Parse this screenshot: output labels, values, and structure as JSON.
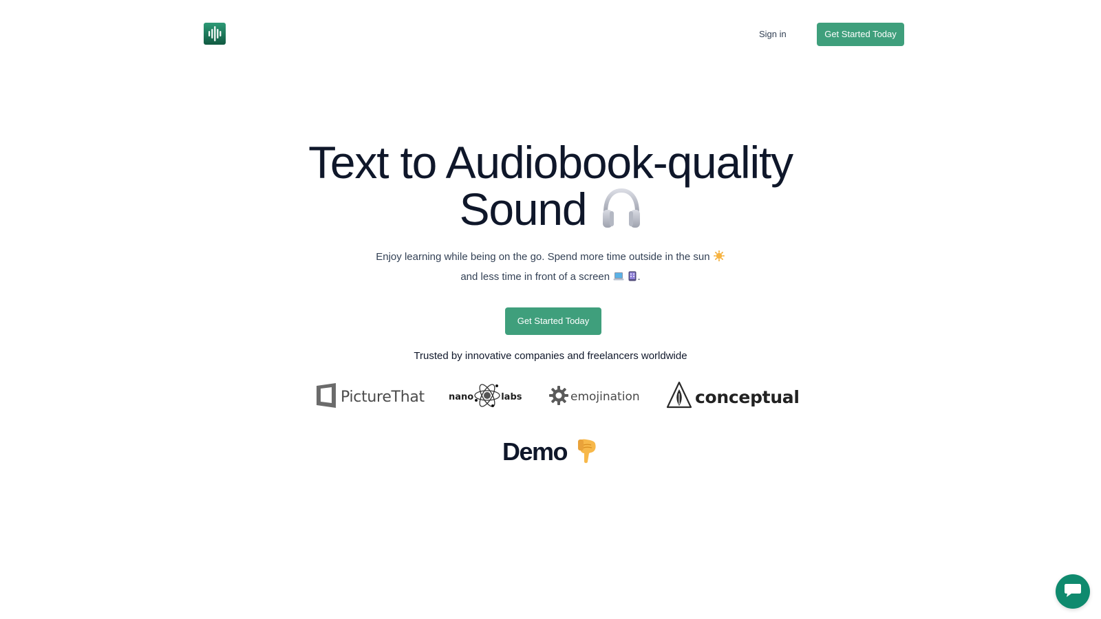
{
  "header": {
    "signin_label": "Sign in",
    "cta_label": "Get Started Today",
    "logo_icon": "sound-wave-icon"
  },
  "hero": {
    "title_line1": "Text to Audiobook-quality",
    "title_line2": "Sound",
    "title_icon": "headphones-icon",
    "subtitle_line1": "Enjoy learning while being on the go. Spend more time outside in the sun",
    "subtitle_line2": "and less time in front of a screen",
    "subtitle_end": ".",
    "subtitle_icons": [
      "sun-icon",
      "laptop-icon",
      "tablet-icon"
    ],
    "cta_label": "Get Started Today",
    "trusted_text": "Trusted by innovative companies and freelancers worldwide"
  },
  "companies": [
    {
      "name": "PictureThat",
      "icon": "picturethat-logo-icon"
    },
    {
      "name_left": "nano",
      "name_right": "labs",
      "icon": "atom-icon"
    },
    {
      "name": "emojination",
      "icon": "gear-icon"
    },
    {
      "name": "conceptual",
      "icon": "pen-nib-icon"
    }
  ],
  "demo": {
    "label": "Demo",
    "icon": "pointing-down-icon"
  },
  "chat": {
    "icon": "chat-bubble-icon"
  },
  "colors": {
    "brand_green": "#3f9f7c",
    "text_dark": "#0f172a",
    "text_muted": "#334155",
    "chat_green": "#0f8a6e"
  }
}
